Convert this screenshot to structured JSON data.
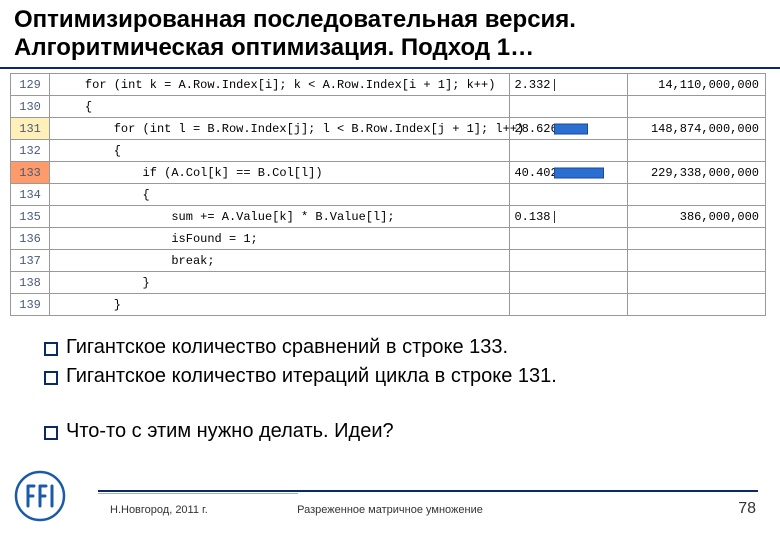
{
  "title_line1": "Оптимизированная последовательная версия.",
  "title_line2": "Алгоритмическая оптимизация. Подход 1…",
  "code": {
    "rows": [
      {
        "ln": "129",
        "hl": "",
        "text": "    for (int k = A.Row.Index[i]; k < A.Row.Index[i + 1]; k++)",
        "barLabel": "2.332",
        "barW": "1",
        "tick": true,
        "count": "14,110,000,000"
      },
      {
        "ln": "130",
        "hl": "",
        "text": "    {",
        "barLabel": "",
        "barW": "",
        "tick": false,
        "count": ""
      },
      {
        "ln": "131",
        "hl": "hot",
        "text": "        for (int l = B.Row.Index[j]; l < B.Row.Index[j + 1]; l++)",
        "barLabel": "28.626",
        "barW": "34",
        "tick": false,
        "count": "148,874,000,000"
      },
      {
        "ln": "132",
        "hl": "",
        "text": "        {",
        "barLabel": "",
        "barW": "",
        "tick": false,
        "count": ""
      },
      {
        "ln": "133",
        "hl": "hottest",
        "text": "            if (A.Col[k] == B.Col[l])",
        "barLabel": "40.402",
        "barW": "50",
        "tick": false,
        "count": "229,338,000,000"
      },
      {
        "ln": "134",
        "hl": "",
        "text": "            {",
        "barLabel": "",
        "barW": "",
        "tick": false,
        "count": ""
      },
      {
        "ln": "135",
        "hl": "",
        "text": "                sum += A.Value[k] * B.Value[l];",
        "barLabel": "0.138",
        "barW": "1",
        "tick": true,
        "count": "386,000,000"
      },
      {
        "ln": "136",
        "hl": "",
        "text": "                isFound = 1;",
        "barLabel": "",
        "barW": "",
        "tick": false,
        "count": ""
      },
      {
        "ln": "137",
        "hl": "",
        "text": "                break;",
        "barLabel": "",
        "barW": "",
        "tick": false,
        "count": ""
      },
      {
        "ln": "138",
        "hl": "",
        "text": "            }",
        "barLabel": "",
        "barW": "",
        "tick": false,
        "count": ""
      },
      {
        "ln": "139",
        "hl": "",
        "text": "        }",
        "barLabel": "",
        "barW": "",
        "tick": false,
        "count": ""
      }
    ]
  },
  "bullets": {
    "b1": "Гигантское количество сравнений в строке 133.",
    "b2": "Гигантское количество итераций цикла в строке 131.",
    "b3": "Что-то с этим нужно делать. Идеи?"
  },
  "footer": {
    "left": "Н.Новгород, 2011 г.",
    "center": "Разреженное матричное умножение",
    "page": "78"
  }
}
